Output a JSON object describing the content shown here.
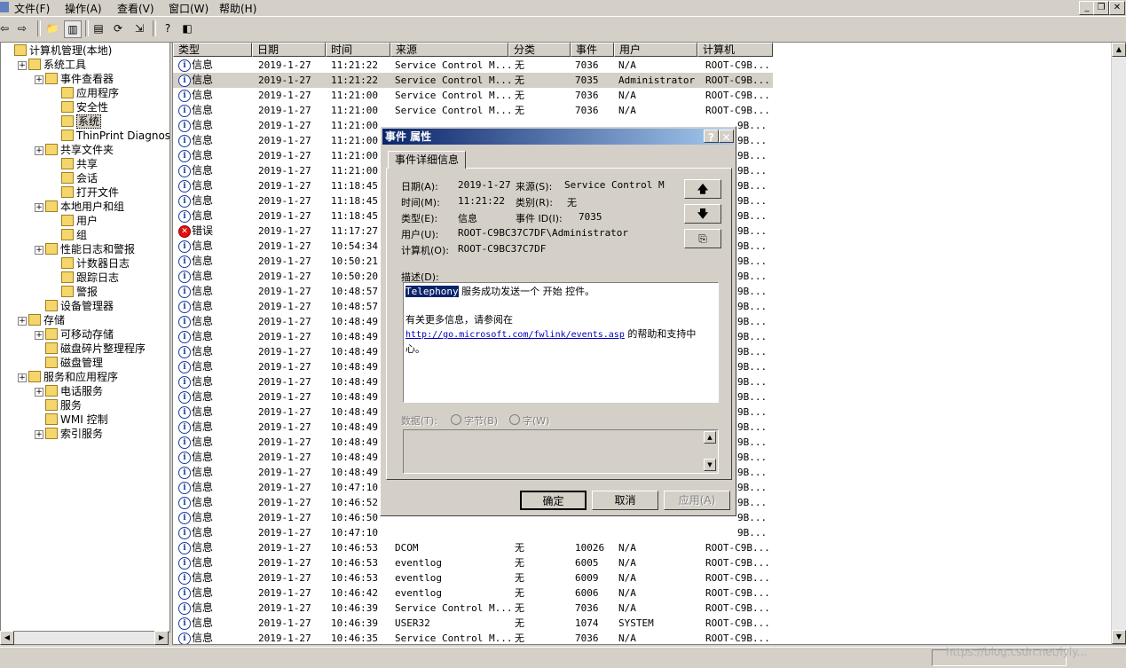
{
  "menu": [
    "文件(F)",
    "操作(A)",
    "查看(V)",
    "窗口(W)",
    "帮助(H)"
  ],
  "tree": [
    {
      "label": "计算机管理(本地)",
      "level": 0,
      "plus": false
    },
    {
      "label": "系统工具",
      "level": 1,
      "plus": true
    },
    {
      "label": "事件查看器",
      "level": 2,
      "plus": true
    },
    {
      "label": "应用程序",
      "level": 3,
      "plus": false
    },
    {
      "label": "安全性",
      "level": 3,
      "plus": false
    },
    {
      "label": "系统",
      "level": 3,
      "plus": false,
      "selected": true
    },
    {
      "label": "ThinPrint Diagnosti",
      "level": 3,
      "plus": false
    },
    {
      "label": "共享文件夹",
      "level": 2,
      "plus": true
    },
    {
      "label": "共享",
      "level": 3,
      "plus": false
    },
    {
      "label": "会话",
      "level": 3,
      "plus": false
    },
    {
      "label": "打开文件",
      "level": 3,
      "plus": false
    },
    {
      "label": "本地用户和组",
      "level": 2,
      "plus": true
    },
    {
      "label": "用户",
      "level": 3,
      "plus": false
    },
    {
      "label": "组",
      "level": 3,
      "plus": false
    },
    {
      "label": "性能日志和警报",
      "level": 2,
      "plus": true
    },
    {
      "label": "计数器日志",
      "level": 3,
      "plus": false
    },
    {
      "label": "跟踪日志",
      "level": 3,
      "plus": false
    },
    {
      "label": "警报",
      "level": 3,
      "plus": false
    },
    {
      "label": "设备管理器",
      "level": 2,
      "plus": false
    },
    {
      "label": "存储",
      "level": 1,
      "plus": true
    },
    {
      "label": "可移动存储",
      "level": 2,
      "plus": true
    },
    {
      "label": "磁盘碎片整理程序",
      "level": 2,
      "plus": false
    },
    {
      "label": "磁盘管理",
      "level": 2,
      "plus": false
    },
    {
      "label": "服务和应用程序",
      "level": 1,
      "plus": true
    },
    {
      "label": "电话服务",
      "level": 2,
      "plus": true
    },
    {
      "label": "服务",
      "level": 2,
      "plus": false
    },
    {
      "label": "WMI 控制",
      "level": 2,
      "plus": false
    },
    {
      "label": "索引服务",
      "level": 2,
      "plus": true
    }
  ],
  "columns": [
    "类型",
    "日期",
    "时间",
    "来源",
    "分类",
    "事件",
    "用户",
    "计算机"
  ],
  "rows": [
    {
      "type": "信息",
      "date": "2019-1-27",
      "time": "11:21:22",
      "source": "Service Control M...",
      "cat": "无",
      "event": "7036",
      "user": "N/A",
      "computer": "ROOT-C9B..."
    },
    {
      "type": "信息",
      "date": "2019-1-27",
      "time": "11:21:22",
      "source": "Service Control M...",
      "cat": "无",
      "event": "7035",
      "user": "Administrator",
      "computer": "ROOT-C9B...",
      "hl": true
    },
    {
      "type": "信息",
      "date": "2019-1-27",
      "time": "11:21:00",
      "source": "Service Control M...",
      "cat": "无",
      "event": "7036",
      "user": "N/A",
      "computer": "ROOT-C9B..."
    },
    {
      "type": "信息",
      "date": "2019-1-27",
      "time": "11:21:00",
      "source": "Service Control M...",
      "cat": "无",
      "event": "7036",
      "user": "N/A",
      "computer": "ROOT-C9B..."
    },
    {
      "type": "信息",
      "date": "2019-1-27",
      "time": "11:21:00",
      "source": "",
      "cat": "",
      "event": "",
      "user": "",
      "computer": ""
    },
    {
      "type": "信息",
      "date": "2019-1-27",
      "time": "11:21:00",
      "source": "",
      "cat": "",
      "event": "",
      "user": "",
      "computer": ""
    },
    {
      "type": "信息",
      "date": "2019-1-27",
      "time": "11:21:00",
      "source": "",
      "cat": "",
      "event": "",
      "user": "",
      "computer": ""
    },
    {
      "type": "信息",
      "date": "2019-1-27",
      "time": "11:21:00",
      "source": "",
      "cat": "",
      "event": "",
      "user": "",
      "computer": ""
    },
    {
      "type": "信息",
      "date": "2019-1-27",
      "time": "11:18:45",
      "source": "",
      "cat": "",
      "event": "",
      "user": "",
      "computer": ""
    },
    {
      "type": "信息",
      "date": "2019-1-27",
      "time": "11:18:45",
      "source": "",
      "cat": "",
      "event": "",
      "user": "",
      "computer": ""
    },
    {
      "type": "信息",
      "date": "2019-1-27",
      "time": "11:18:45",
      "source": "",
      "cat": "",
      "event": "",
      "user": "",
      "computer": ""
    },
    {
      "type": "错误",
      "date": "2019-1-27",
      "time": "11:17:27",
      "source": "",
      "cat": "",
      "event": "",
      "user": "",
      "computer": "",
      "err": true
    },
    {
      "type": "信息",
      "date": "2019-1-27",
      "time": "10:54:34",
      "source": "",
      "cat": "",
      "event": "",
      "user": "",
      "computer": ""
    },
    {
      "type": "信息",
      "date": "2019-1-27",
      "time": "10:50:21",
      "source": "",
      "cat": "",
      "event": "",
      "user": "",
      "computer": ""
    },
    {
      "type": "信息",
      "date": "2019-1-27",
      "time": "10:50:20",
      "source": "",
      "cat": "",
      "event": "",
      "user": "",
      "computer": ""
    },
    {
      "type": "信息",
      "date": "2019-1-27",
      "time": "10:48:57",
      "source": "",
      "cat": "",
      "event": "",
      "user": "",
      "computer": ""
    },
    {
      "type": "信息",
      "date": "2019-1-27",
      "time": "10:48:57",
      "source": "",
      "cat": "",
      "event": "",
      "user": "",
      "computer": ""
    },
    {
      "type": "信息",
      "date": "2019-1-27",
      "time": "10:48:49",
      "source": "",
      "cat": "",
      "event": "",
      "user": "",
      "computer": ""
    },
    {
      "type": "信息",
      "date": "2019-1-27",
      "time": "10:48:49",
      "source": "",
      "cat": "",
      "event": "",
      "user": "",
      "computer": ""
    },
    {
      "type": "信息",
      "date": "2019-1-27",
      "time": "10:48:49",
      "source": "",
      "cat": "",
      "event": "",
      "user": "",
      "computer": ""
    },
    {
      "type": "信息",
      "date": "2019-1-27",
      "time": "10:48:49",
      "source": "",
      "cat": "",
      "event": "",
      "user": "",
      "computer": ""
    },
    {
      "type": "信息",
      "date": "2019-1-27",
      "time": "10:48:49",
      "source": "",
      "cat": "",
      "event": "",
      "user": "",
      "computer": ""
    },
    {
      "type": "信息",
      "date": "2019-1-27",
      "time": "10:48:49",
      "source": "",
      "cat": "",
      "event": "",
      "user": "",
      "computer": ""
    },
    {
      "type": "信息",
      "date": "2019-1-27",
      "time": "10:48:49",
      "source": "",
      "cat": "",
      "event": "",
      "user": "",
      "computer": ""
    },
    {
      "type": "信息",
      "date": "2019-1-27",
      "time": "10:48:49",
      "source": "",
      "cat": "",
      "event": "",
      "user": "",
      "computer": ""
    },
    {
      "type": "信息",
      "date": "2019-1-27",
      "time": "10:48:49",
      "source": "",
      "cat": "",
      "event": "",
      "user": "",
      "computer": ""
    },
    {
      "type": "信息",
      "date": "2019-1-27",
      "time": "10:48:49",
      "source": "",
      "cat": "",
      "event": "",
      "user": "",
      "computer": ""
    },
    {
      "type": "信息",
      "date": "2019-1-27",
      "time": "10:48:49",
      "source": "",
      "cat": "",
      "event": "",
      "user": "",
      "computer": ""
    },
    {
      "type": "信息",
      "date": "2019-1-27",
      "time": "10:47:10",
      "source": "",
      "cat": "",
      "event": "",
      "user": "",
      "computer": ""
    },
    {
      "type": "信息",
      "date": "2019-1-27",
      "time": "10:46:52",
      "source": "",
      "cat": "",
      "event": "",
      "user": "",
      "computer": ""
    },
    {
      "type": "信息",
      "date": "2019-1-27",
      "time": "10:46:50",
      "source": "",
      "cat": "",
      "event": "",
      "user": "",
      "computer": ""
    },
    {
      "type": "信息",
      "date": "2019-1-27",
      "time": "10:47:10",
      "source": "",
      "cat": "",
      "event": "",
      "user": "",
      "computer": ""
    },
    {
      "type": "信息",
      "date": "2019-1-27",
      "time": "10:46:53",
      "source": "DCOM",
      "cat": "无",
      "event": "10026",
      "user": "N/A",
      "computer": "ROOT-C9B..."
    },
    {
      "type": "信息",
      "date": "2019-1-27",
      "time": "10:46:53",
      "source": "eventlog",
      "cat": "无",
      "event": "6005",
      "user": "N/A",
      "computer": "ROOT-C9B..."
    },
    {
      "type": "信息",
      "date": "2019-1-27",
      "time": "10:46:53",
      "source": "eventlog",
      "cat": "无",
      "event": "6009",
      "user": "N/A",
      "computer": "ROOT-C9B..."
    },
    {
      "type": "信息",
      "date": "2019-1-27",
      "time": "10:46:42",
      "source": "eventlog",
      "cat": "无",
      "event": "6006",
      "user": "N/A",
      "computer": "ROOT-C9B..."
    },
    {
      "type": "信息",
      "date": "2019-1-27",
      "time": "10:46:39",
      "source": "Service Control M...",
      "cat": "无",
      "event": "7036",
      "user": "N/A",
      "computer": "ROOT-C9B..."
    },
    {
      "type": "信息",
      "date": "2019-1-27",
      "time": "10:46:39",
      "source": "USER32",
      "cat": "无",
      "event": "1074",
      "user": "SYSTEM",
      "computer": "ROOT-C9B..."
    },
    {
      "type": "信息",
      "date": "2019-1-27",
      "time": "10:46:35",
      "source": "Service Control M...",
      "cat": "无",
      "event": "7036",
      "user": "N/A",
      "computer": "ROOT-C9B..."
    },
    {
      "type": "信息",
      "date": "2019-1-27",
      "time": "10:46:35",
      "source": "Service Control M...",
      "cat": "无",
      "event": "7035",
      "user": "SYSTEM",
      "computer": "ROOT-C9B..."
    }
  ],
  "right_col_fragment": "9B...",
  "dialog": {
    "title": "事件 属性",
    "tab": "事件详细信息",
    "date_label": "日期(A):",
    "date_value": "2019-1-27",
    "source_label": "来源(S):",
    "source_value": "Service Control M",
    "time_label": "时间(M):",
    "time_value": "11:21:22",
    "category_label": "类别(R):",
    "category_value": "无",
    "type_label": "类型(E):",
    "type_value": "信息",
    "eventid_label": "事件 ID(I):",
    "eventid_value": "7035",
    "user_label": "用户(U):",
    "user_value": "ROOT-C9BC37C7DF\\Administrator",
    "computer_label": "计算机(O):",
    "computer_value": "ROOT-C9BC37C7DF",
    "desc_label": "描述(D):",
    "desc_highlight": "Telephony",
    "desc_line1": " 服务成功发送一个 开始 控件。",
    "desc_line2": "有关更多信息，请参阅在",
    "desc_link": "http://go.microsoft.com/fwlink/events.asp",
    "desc_line3": " 的帮助和支持中",
    "desc_line4": "心。",
    "data_label": "数据(T):",
    "bytes_label": "字节(B)",
    "words_label": "字(W)",
    "ok": "确定",
    "cancel": "取消",
    "apply": "应用(A)",
    "up_arrow": "🡅",
    "down_arrow": "🡇",
    "copy_icon": "⎘"
  },
  "watermark": "https://blog.csdn.net/lyly..."
}
